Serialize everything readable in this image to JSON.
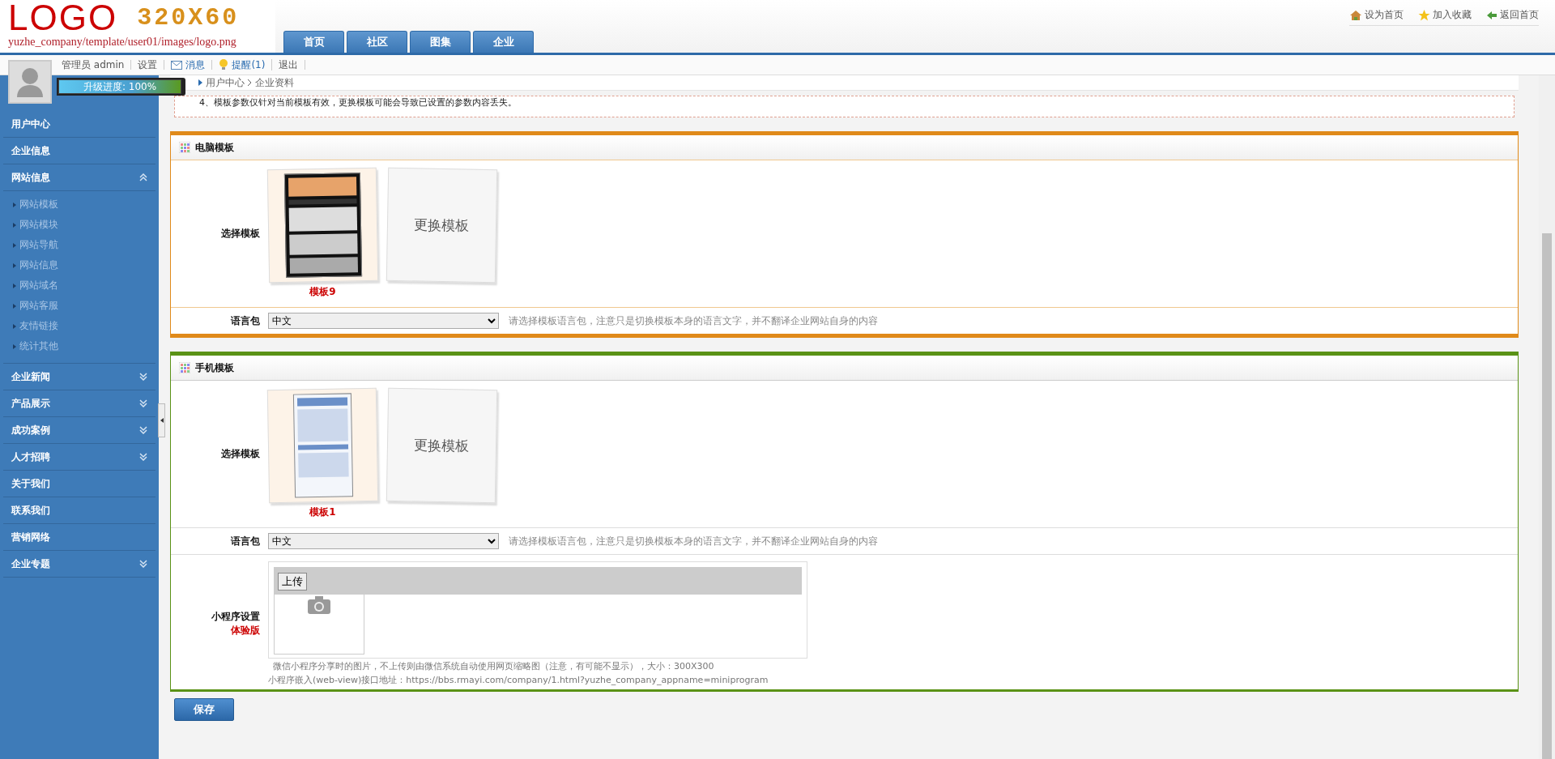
{
  "logo": {
    "title": "LOGO",
    "size": "320X60",
    "path": "yuzhe_company/template/user01/images/logo.png"
  },
  "nav_tabs": [
    {
      "label": "首页"
    },
    {
      "label": "社区"
    },
    {
      "label": "图集"
    },
    {
      "label": "企业"
    }
  ],
  "top_links": [
    {
      "kind": "home",
      "label": "设为首页"
    },
    {
      "kind": "star",
      "label": "加入收藏"
    },
    {
      "kind": "back",
      "label": "返回首页"
    }
  ],
  "user_bar": {
    "items": [
      {
        "kind": "text",
        "label": "管理员 admin"
      },
      {
        "kind": "link",
        "label": "设置"
      },
      {
        "kind": "mail",
        "label": "消息"
      },
      {
        "kind": "bulb",
        "label": "提醒(1)"
      },
      {
        "kind": "link",
        "label": "退出"
      }
    ],
    "progress": {
      "label": "升级进度: 100%",
      "level": 1
    }
  },
  "breadcrumb": [
    "用户中心",
    "企业资料"
  ],
  "sidebar": {
    "items": [
      {
        "label": "用户中心"
      },
      {
        "label": "企业信息"
      },
      {
        "label": "网站信息",
        "expanded": true,
        "children": [
          {
            "label": "网站模板"
          },
          {
            "label": "网站模块"
          },
          {
            "label": "网站导航"
          },
          {
            "label": "网站信息"
          },
          {
            "label": "网站域名"
          },
          {
            "label": "网站客服"
          },
          {
            "label": "友情链接"
          },
          {
            "label": "统计其他"
          }
        ]
      },
      {
        "label": "企业新闻",
        "expanded": false
      },
      {
        "label": "产品展示",
        "expanded": false
      },
      {
        "label": "成功案例",
        "expanded": false
      },
      {
        "label": "人才招聘",
        "expanded": false
      },
      {
        "label": "关于我们"
      },
      {
        "label": "联系我们"
      },
      {
        "label": "营销网络"
      },
      {
        "label": "企业专题",
        "expanded": false
      }
    ]
  },
  "notice": [
    "4、模板参数仅针对当前模板有效，更换模板可能会导致已设置的参数内容丢失。"
  ],
  "sections": [
    {
      "title": "电脑模板",
      "color": "#e08a1a",
      "kind": "pc",
      "template_label": "选择模板",
      "template_name": "模板9",
      "change_label": "更换模板",
      "language_label": "语言包",
      "language_value": "中文",
      "language_hint": "请选择模板语言包，注意只是切换模板本身的语言文字，并不翻译企业网站自身的内容"
    },
    {
      "title": "手机模板",
      "color": "#5a9216",
      "kind": "mobile",
      "template_label": "选择模板",
      "template_name": "模板1",
      "change_label": "更换模板",
      "language_label": "语言包",
      "language_value": "中文",
      "language_hint": "请选择模板语言包，注意只是切换模板本身的语言文字，并不翻译企业网站自身的内容",
      "miniprogram": {
        "label": "小程序设置",
        "badge": "体验版",
        "upload_button": "上传",
        "hint": "微信小程序分享时的图片，不上传则由微信系统自动使用网页缩略图（注意，有可能不显示），大小：300X300",
        "api_note": "小程序嵌入(web-view)接口地址：https://bbs.rmayi.com/company/1.html?yuzhe_company_appname=miniprogram"
      }
    }
  ],
  "save_button": "保存"
}
